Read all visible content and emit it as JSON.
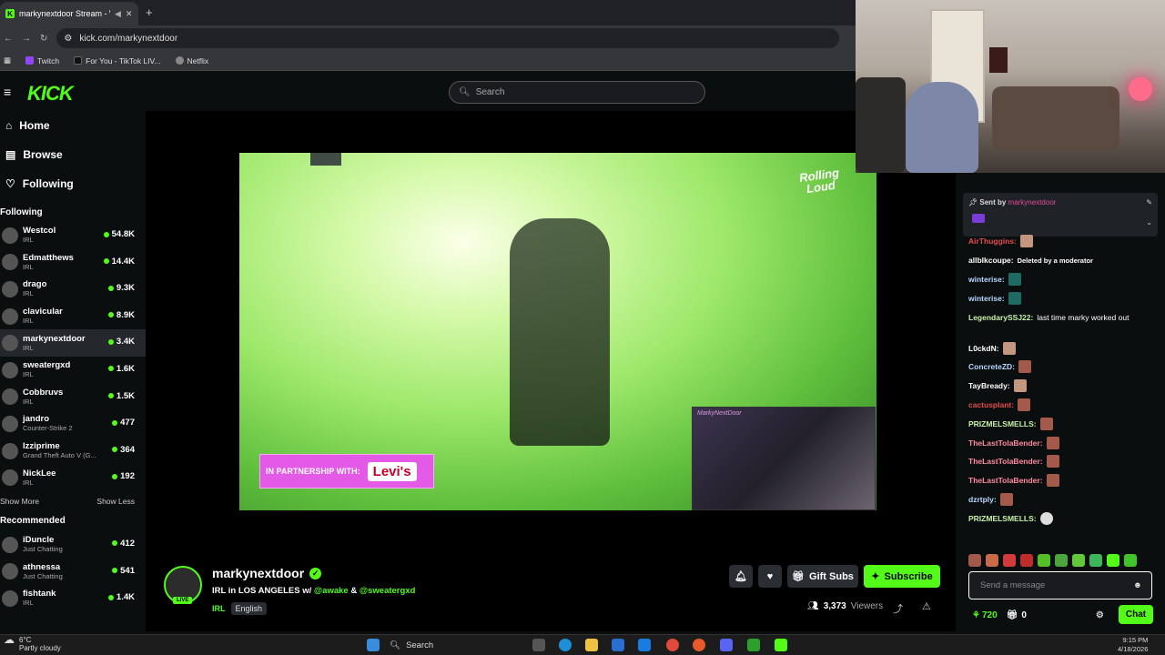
{
  "browser": {
    "tab_title": "markynextdoor Stream - Wa",
    "url": "kick.com/markynextdoor",
    "bookmarks": [
      {
        "label": "Twitch",
        "color": "#9146ff"
      },
      {
        "label": "For You - TikTok LIV...",
        "color": "#111111"
      },
      {
        "label": "Netflix",
        "color": "#888888"
      }
    ]
  },
  "header": {
    "logo": "KICK",
    "search_placeholder": "Search"
  },
  "sidebar": {
    "nav": [
      {
        "label": "Home",
        "icon": "home-icon"
      },
      {
        "label": "Browse",
        "icon": "browse-icon"
      },
      {
        "label": "Following",
        "icon": "heart-icon"
      }
    ],
    "following_title": "Following",
    "following": [
      {
        "name": "Westcol",
        "category": "IRL",
        "viewers": "54.8K"
      },
      {
        "name": "Edmatthews",
        "category": "IRL",
        "viewers": "14.4K"
      },
      {
        "name": "drago",
        "category": "IRL",
        "viewers": "9.3K"
      },
      {
        "name": "clavicular",
        "category": "IRL",
        "viewers": "8.9K"
      },
      {
        "name": "markynextdoor",
        "category": "IRL",
        "viewers": "3.4K"
      },
      {
        "name": "sweatergxd",
        "category": "IRL",
        "viewers": "1.6K"
      },
      {
        "name": "Cobbruvs",
        "category": "IRL",
        "viewers": "1.5K"
      },
      {
        "name": "jandro",
        "category": "Counter-Strike 2",
        "viewers": "477"
      },
      {
        "name": "Izziprime",
        "category": "Grand Theft Auto V (G...",
        "viewers": "364"
      },
      {
        "name": "NickLee",
        "category": "IRL",
        "viewers": "192"
      }
    ],
    "show_more": "Show More",
    "show_less": "Show Less",
    "recommended_title": "Recommended",
    "recommended": [
      {
        "name": "iDuncle",
        "category": "Just Chatting",
        "viewers": "412"
      },
      {
        "name": "athnessa",
        "category": "Just Chatting",
        "viewers": "541"
      },
      {
        "name": "fishtank",
        "category": "IRL",
        "viewers": "1.4K"
      }
    ]
  },
  "video": {
    "partner_text": "IN PARTNERSHIP WITH:",
    "partner_brand": "Levi's",
    "festival_logo": "Rolling Loud",
    "cam_name": "MarkyNextDoor"
  },
  "stream": {
    "streamer": "markynextdoor",
    "live_badge": "LIVE",
    "title_prefix": "IRL in LOS ANGELES w/",
    "collab1": "@awake",
    "amp": "&",
    "collab2": "@sweatergxd",
    "category": "IRL",
    "language": "English",
    "gift_subs": "Gift Subs",
    "subscribe": "Subscribe",
    "viewers": "3,373",
    "viewers_label": "Viewers"
  },
  "chat": {
    "pinned_by_label": "Sent by",
    "pinned_by": "markynextdoor",
    "messages": [
      {
        "user": "AirThuggins:",
        "color": "#e34d4d",
        "text": "",
        "emote": "face"
      },
      {
        "user": "allblkcoupe:",
        "color": "#ffffff",
        "text": "Deleted by a moderator",
        "emote": ""
      },
      {
        "user": "winterise:",
        "color": "#b7d7ff",
        "text": "",
        "emote": "teal"
      },
      {
        "user": "winterise:",
        "color": "#b7d7ff",
        "text": "",
        "emote": "teal"
      },
      {
        "user": "LegendarySSJ22:",
        "color": "#c7f1a8",
        "text": "last time marky worked out",
        "emote": "",
        "tall": true
      },
      {
        "user": "L0ckdN:",
        "color": "#ffffff",
        "text": "",
        "emote": "face"
      },
      {
        "user": "ConcreteZD:",
        "color": "#b7d7ff",
        "text": "",
        "emote": "red"
      },
      {
        "user": "TayBready:",
        "color": "#ffffff",
        "text": "",
        "emote": "face"
      },
      {
        "user": "cactusplant:",
        "color": "#e34d4d",
        "text": "",
        "emote": "red"
      },
      {
        "user": "PRIZMELSMELLS:",
        "color": "#c7f1a8",
        "text": "",
        "emote": "red"
      },
      {
        "user": "TheLastTolaBender:",
        "color": "#ff8aa0",
        "text": "",
        "emote": "red"
      },
      {
        "user": "TheLastTolaBender:",
        "color": "#ff8aa0",
        "text": "",
        "emote": "red"
      },
      {
        "user": "TheLastTolaBender:",
        "color": "#ff8aa0",
        "text": "",
        "emote": "red"
      },
      {
        "user": "dzrtply:",
        "color": "#b7d7ff",
        "text": "",
        "emote": "red"
      },
      {
        "user": "PRIZMELSMELLS:",
        "color": "#c7f1a8",
        "text": "",
        "emote": "skull"
      }
    ],
    "input_placeholder": "Send a message",
    "points": "720",
    "gifts": "0",
    "send_label": "Chat"
  },
  "taskbar": {
    "temp": "6°C",
    "condition": "Partly cloudy",
    "search": "Search",
    "time": "9:15 PM",
    "date": "4/18/2026"
  }
}
